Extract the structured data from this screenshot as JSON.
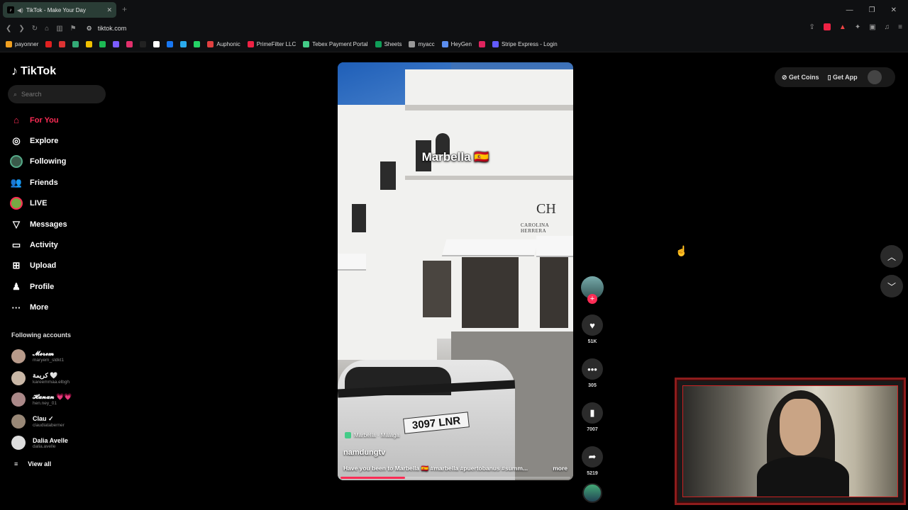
{
  "browser": {
    "tab_title": "TikTok - Make Your Day",
    "url": "tiktok.com",
    "bookmarks": [
      {
        "label": "payonner",
        "color": "#f0a020"
      },
      {
        "label": "",
        "color": "#e02020"
      },
      {
        "label": "",
        "color": "#d33"
      },
      {
        "label": "",
        "color": "#3a7"
      },
      {
        "label": "",
        "color": "#f0c000"
      },
      {
        "label": "",
        "color": "#1db954"
      },
      {
        "label": "",
        "color": "#7b5cff"
      },
      {
        "label": "",
        "color": "#e1306c"
      },
      {
        "label": "",
        "color": "#222"
      },
      {
        "label": "",
        "color": "#fff"
      },
      {
        "label": "",
        "color": "#1877f2"
      },
      {
        "label": "",
        "color": "#2aabee"
      },
      {
        "label": "",
        "color": "#25d366"
      },
      {
        "label": "Auphonic",
        "color": "#e04040"
      },
      {
        "label": "PrimeFilter LLC",
        "color": "#e24"
      },
      {
        "label": "Tebex Payment Portal",
        "color": "#4c8"
      },
      {
        "label": "Sheets",
        "color": "#0f9d58"
      },
      {
        "label": "myacc",
        "color": "#999"
      },
      {
        "label": "HeyGen",
        "color": "#5b8def"
      },
      {
        "label": "",
        "color": "#e0245e"
      },
      {
        "label": "Stripe Express - Login",
        "color": "#635bff"
      }
    ]
  },
  "sidebar": {
    "logo": "TikTok",
    "search_placeholder": "Search",
    "nav": [
      {
        "label": "For You",
        "icon": "home-icon",
        "glyph": "⌂"
      },
      {
        "label": "Explore",
        "icon": "compass-icon",
        "glyph": "◎"
      },
      {
        "label": "Following",
        "icon": "avatar-icon",
        "glyph": ""
      },
      {
        "label": "Friends",
        "icon": "friends-icon",
        "glyph": "👥"
      },
      {
        "label": "LIVE",
        "icon": "live-avatar-icon",
        "glyph": ""
      },
      {
        "label": "Messages",
        "icon": "messages-icon",
        "glyph": "▽"
      },
      {
        "label": "Activity",
        "icon": "activity-icon",
        "glyph": "▭"
      },
      {
        "label": "Upload",
        "icon": "upload-icon",
        "glyph": "⊞"
      },
      {
        "label": "Profile",
        "icon": "profile-icon",
        "glyph": "♟"
      },
      {
        "label": "More",
        "icon": "more-icon",
        "glyph": "···"
      }
    ],
    "following_title": "Following accounts",
    "following": [
      {
        "name": "𝓜𝓮𝓻𝓮𝓶",
        "handle": "maryem_sldkt1"
      },
      {
        "name": "كريمة 🤍",
        "handle": "kareemmaa.elbgh"
      },
      {
        "name": "𝓗𝓪𝓷𝓪𝓷 💗💗",
        "handle": "hen.ney_01"
      },
      {
        "name": "Clau ✓",
        "handle": "claudiataberner"
      },
      {
        "name": "Dalia Avelle",
        "handle": "dalia.avelle"
      }
    ],
    "view_all": "View all"
  },
  "video": {
    "overlay_text": "Marbella 🇪🇸",
    "store_brand": "CH",
    "store_sub": "CAROLINA HERRERA",
    "plate": "3097 LNR",
    "location": "Marbella · Málaga",
    "author": "namdungtv",
    "caption": "Have you been to Marbella 🇪🇸 #marbella #puertobanus #summ...",
    "more": "more",
    "progress": 0.28
  },
  "actions": {
    "likes": "51K",
    "comments": "305",
    "saves": "7007",
    "shares": "5219"
  },
  "topbar": {
    "get_coins": "Get Coins",
    "get_app": "Get App"
  }
}
